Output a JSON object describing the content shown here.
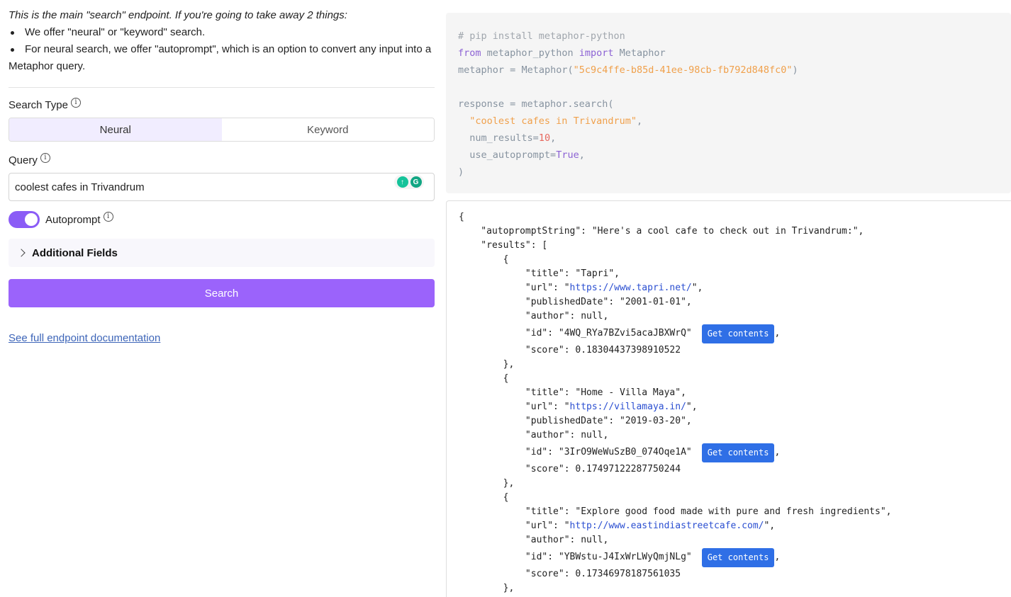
{
  "intro": {
    "lead": "This is the main \"search\" endpoint. If you're going to take away 2 things:",
    "bullets": [
      "We offer \"neural\" or \"keyword\" search.",
      "For neural search, we offer \"autoprompt\", which is an option to convert any input into a Metaphor query."
    ]
  },
  "form": {
    "search_type_label": "Search Type",
    "search_types": [
      "Neural",
      "Keyword"
    ],
    "selected_search_type": "Neural",
    "query_label": "Query",
    "query_value": "coolest cafes in Trivandrum",
    "autoprompt_label": "Autoprompt",
    "autoprompt_enabled": true,
    "additional_fields_label": "Additional Fields",
    "search_button": "Search",
    "docs_link": "See full endpoint documentation"
  },
  "code": {
    "comment": "# pip install metaphor-python",
    "kw_from": "from",
    "module": "metaphor_python",
    "kw_import": "import",
    "class_name": "Metaphor",
    "var": "metaphor",
    "eq": "=",
    "api_key": "\"5c9c4ffe-b85d-41ee-98cb-fb792d848fc0\"",
    "response_call": "response = metaphor.search(",
    "query_arg": "\"coolest cafes in Trivandrum\"",
    "num_results_key": "num_results=",
    "num_results_val": "10",
    "use_autoprompt_key": "use_autoprompt=",
    "use_autoprompt_val": "True",
    "close": ")"
  },
  "response": {
    "autopromptString": "Here's a cool cafe to check out in Trivandrum:",
    "get_contents_label": "Get contents",
    "results": [
      {
        "title": "Tapri",
        "url": "https://www.tapri.net/",
        "publishedDate": "2001-01-01",
        "author": "null",
        "id": "4WQ_RYa7BZvi5acaJBXWrQ",
        "score": "0.18304437398910522"
      },
      {
        "title": "Home - Villa Maya",
        "url": "https://villamaya.in/",
        "publishedDate": "2019-03-20",
        "author": "null",
        "id": "3IrO9WeWuSzB0_074Oqe1A",
        "score": "0.17497122287750244"
      },
      {
        "title": "Explore good food made with pure and fresh ingredients",
        "url": "http://www.eastindiastreetcafe.com/",
        "author": "null",
        "id": "YBWstu-J4IxWrLWyQmjNLg",
        "score": "0.17346978187561035"
      }
    ]
  },
  "colors": {
    "accent": "#9b63fb",
    "toggle": "#8b5cf6",
    "active_segment": "#f1edff",
    "get_contents": "#2f6fe6",
    "link": "#3d65b8"
  }
}
